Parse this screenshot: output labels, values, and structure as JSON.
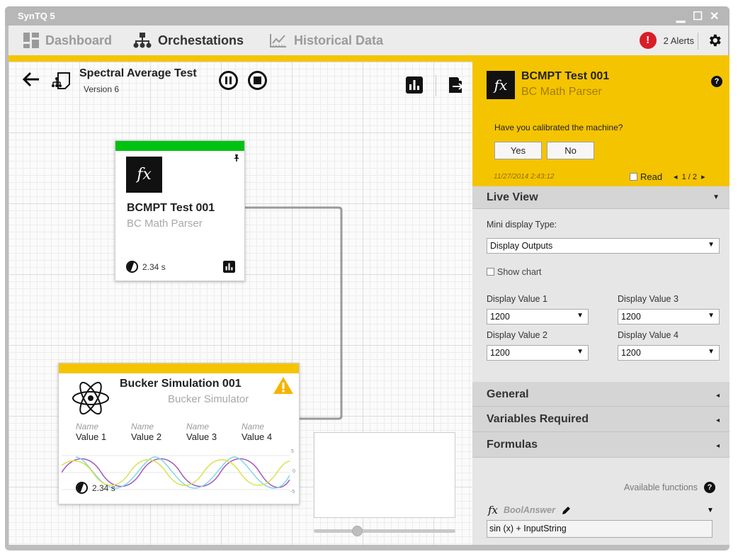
{
  "window": {
    "title": "SynTQ 5",
    "minimize": "▁",
    "maximize": "☐",
    "close": "✕"
  },
  "nav": {
    "items": [
      {
        "label": "Dashboard",
        "icon": "dashboard-icon"
      },
      {
        "label": "Orchestations",
        "icon": "hierarchy-icon"
      },
      {
        "label": "Historical Data",
        "icon": "line-chart-icon"
      }
    ],
    "alerts_badge": "!",
    "alerts_label": "2 Alerts"
  },
  "canvas": {
    "title": "Spectral Average Test",
    "version": "Version 6",
    "node1": {
      "name": "BCMPT Test 001",
      "type": "BC Math Parser",
      "fx": "fx",
      "time": "2.34 s",
      "status_color": "#00c213"
    },
    "node2": {
      "name": "Bucker Simulation 001",
      "type": "Bucker Simulator",
      "time": "2.34 s",
      "status_color": "#f5c400",
      "values": [
        {
          "name": "Name",
          "value": "Value 1"
        },
        {
          "name": "Name",
          "value": "Value 2"
        },
        {
          "name": "Name",
          "value": "Value 3"
        },
        {
          "name": "Name",
          "value": "Value 4"
        }
      ],
      "axis": [
        "5",
        "0",
        "-5"
      ]
    }
  },
  "panel": {
    "notification": {
      "name": "BCMPT Test 001",
      "type": "BC Math Parser",
      "fx": "fx",
      "help": "?",
      "question": "Have you calibrated the machine?",
      "yes": "Yes",
      "no": "No",
      "timestamp": "11/27/2014 2:43:12",
      "read_label": "Read",
      "pager": "1 / 2",
      "prev": "◂",
      "next": "▸"
    },
    "live_view": {
      "title": "Live View",
      "mini_display_label": "Mini display Type:",
      "mini_display_value": "Display Outputs",
      "show_chart": "Show chart",
      "dv1_label": "Display Value 1",
      "dv1": "1200",
      "dv2_label": "Display Value 2",
      "dv2": "1200",
      "dv3_label": "Display Value 3",
      "dv3": "1200",
      "dv4_label": "Display Value 4",
      "dv4": "1200"
    },
    "sections": {
      "general": "General",
      "variables": "Variables Required",
      "formulas": "Formulas"
    },
    "formulas": {
      "available": "Available functions",
      "help": "?",
      "fx": "fx",
      "name": "BoolAnswer",
      "expression": "sin (x) + InputString"
    },
    "caret_down": "▼",
    "caret_left": "◂"
  }
}
